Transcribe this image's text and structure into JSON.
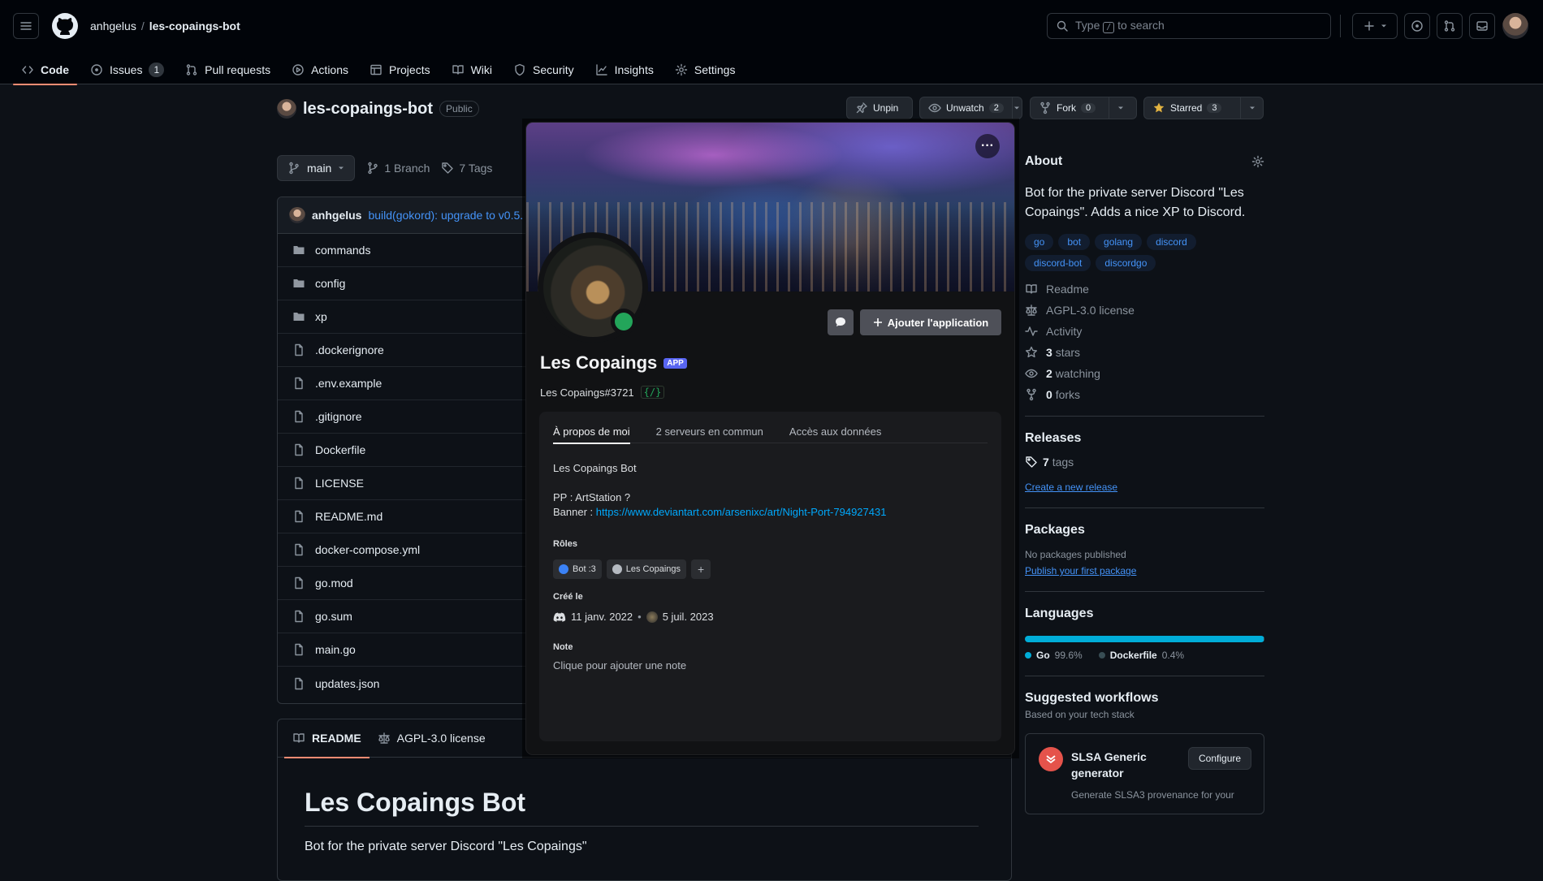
{
  "header": {
    "owner": "anhgelus",
    "separator": "/",
    "repo": "les-copaings-bot",
    "search_prefix": "Type",
    "search_key": "/",
    "search_suffix": "to search"
  },
  "nav_tabs": [
    {
      "label": "Code",
      "icon": "code-icon",
      "active": true
    },
    {
      "label": "Issues",
      "icon": "issue-icon",
      "count": "1"
    },
    {
      "label": "Pull requests",
      "icon": "pr-icon"
    },
    {
      "label": "Actions",
      "icon": "play-icon"
    },
    {
      "label": "Projects",
      "icon": "table-icon"
    },
    {
      "label": "Wiki",
      "icon": "book-icon"
    },
    {
      "label": "Security",
      "icon": "shield-icon"
    },
    {
      "label": "Insights",
      "icon": "graph-icon"
    },
    {
      "label": "Settings",
      "icon": "gear-icon"
    }
  ],
  "repo": {
    "name": "les-copaings-bot",
    "visibility": "Public",
    "unpin": "Unpin",
    "unwatch": "Unwatch",
    "watch_count": "2",
    "fork": "Fork",
    "fork_count": "0",
    "starred": "Starred",
    "star_count": "3"
  },
  "branch": {
    "name": "main",
    "branches": "1 Branch",
    "tags": "7 Tags"
  },
  "commit": {
    "author": "anhgelus",
    "message": "build(gokord): upgrade to v0.5."
  },
  "files": [
    {
      "name": "commands",
      "type": "folder"
    },
    {
      "name": "config",
      "type": "folder"
    },
    {
      "name": "xp",
      "type": "folder"
    },
    {
      "name": ".dockerignore",
      "type": "file"
    },
    {
      "name": ".env.example",
      "type": "file"
    },
    {
      "name": ".gitignore",
      "type": "file"
    },
    {
      "name": "Dockerfile",
      "type": "file"
    },
    {
      "name": "LICENSE",
      "type": "file"
    },
    {
      "name": "README.md",
      "type": "file"
    },
    {
      "name": "docker-compose.yml",
      "type": "file"
    },
    {
      "name": "go.mod",
      "type": "file"
    },
    {
      "name": "go.sum",
      "type": "file"
    },
    {
      "name": "main.go",
      "type": "file"
    },
    {
      "name": "updates.json",
      "type": "file"
    }
  ],
  "readme": {
    "tab_readme": "README",
    "tab_license": "AGPL-3.0 license",
    "title": "Les Copaings Bot",
    "text": "Bot for the private server Discord \"Les Copaings\""
  },
  "about": {
    "heading": "About",
    "description": "Bot for the private server Discord \"Les Copaings\". Adds a nice XP to Discord.",
    "topics": [
      "go",
      "bot",
      "golang",
      "discord",
      "discord-bot",
      "discordgo"
    ],
    "readme": "Readme",
    "license": "AGPL-3.0 license",
    "activity": "Activity",
    "stars_n": "3",
    "stars_label": "stars",
    "watching_n": "2",
    "watching_label": "watching",
    "forks_n": "0",
    "forks_label": "forks"
  },
  "releases": {
    "heading": "Releases",
    "tags_n": "7",
    "tags_label": "tags",
    "create_link": "Create a new release"
  },
  "packages": {
    "heading": "Packages",
    "none": "No packages published",
    "publish_link": "Publish your first package"
  },
  "languages": {
    "heading": "Languages",
    "items": [
      {
        "name": "Go",
        "percent": "99.6%",
        "value": 99.6,
        "color": "#00add8"
      },
      {
        "name": "Dockerfile",
        "percent": "0.4%",
        "value": 0.4,
        "color": "#384d54"
      }
    ]
  },
  "workflows": {
    "heading": "Suggested workflows",
    "sub": "Based on your tech stack",
    "item_title": "SLSA Generic generator",
    "configure": "Configure",
    "item_desc": "Generate SLSA3 provenance for your"
  },
  "popup": {
    "more": "···",
    "add_app": "Ajouter l'application",
    "name": "Les Copaings",
    "badge": "APP",
    "tag": "Les Copaings#3721",
    "slash": "{/}",
    "tabs": [
      "À propos de moi",
      "2 serveurs en commun",
      "Accès aux données"
    ],
    "bio_title": "Les Copaings Bot",
    "bio_pp": "PP : ArtStation ?",
    "bio_banner_prefix": "Banner :",
    "bio_banner_link": "https://www.deviantart.com/arsenixc/art/Night-Port-794927431",
    "roles_label": "Rôles",
    "roles": [
      {
        "name": "Bot :3",
        "color": "#3b82f6"
      },
      {
        "name": "Les Copaings",
        "color": "#b5bac1"
      }
    ],
    "role_add": "+",
    "created_label": "Créé le",
    "created_discord": "11 janv. 2022",
    "created_dot": "•",
    "created_server": "5 juil. 2023",
    "note_label": "Note",
    "note_placeholder": "Clique pour ajouter une note",
    "status_color": "#23a55a"
  }
}
